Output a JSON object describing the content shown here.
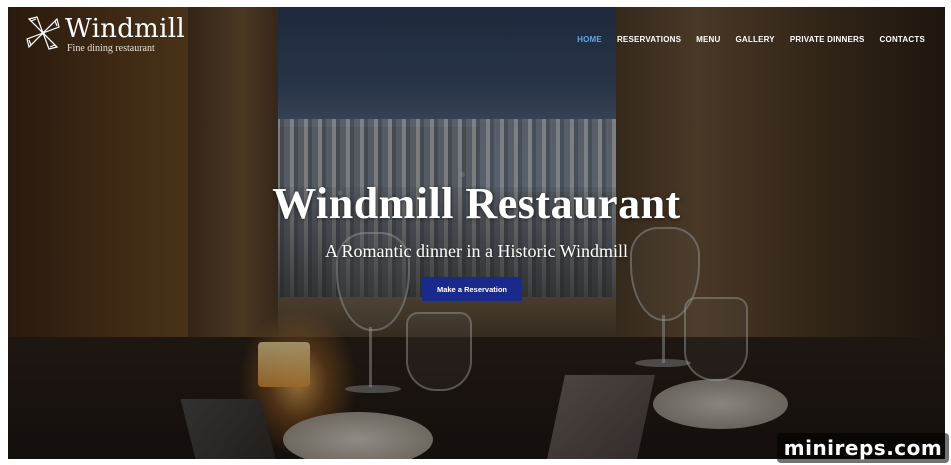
{
  "brand": {
    "name": "Windmill",
    "tagline": "Fine dining restaurant",
    "logo_icon": "windmill-icon"
  },
  "nav": {
    "items": [
      {
        "label": "HOME",
        "active": true
      },
      {
        "label": "RESERVATIONS",
        "active": false
      },
      {
        "label": "MENU",
        "active": false
      },
      {
        "label": "GALLERY",
        "active": false
      },
      {
        "label": "PRIVATE DINNERS",
        "active": false
      },
      {
        "label": "CONTACTS",
        "active": false
      }
    ],
    "active_color": "#5aa6e6",
    "color": "#ffffff"
  },
  "hero": {
    "title": "Windmill Restaurant",
    "subtitle": "A Romantic dinner in a Historic Windmill",
    "cta_label": "Make a Reservation",
    "cta_color": "#1a2a8c",
    "background_image": "candlelit table with wine glasses overlooking coastal town at dusk"
  },
  "watermark": {
    "text": "minireps.com"
  }
}
